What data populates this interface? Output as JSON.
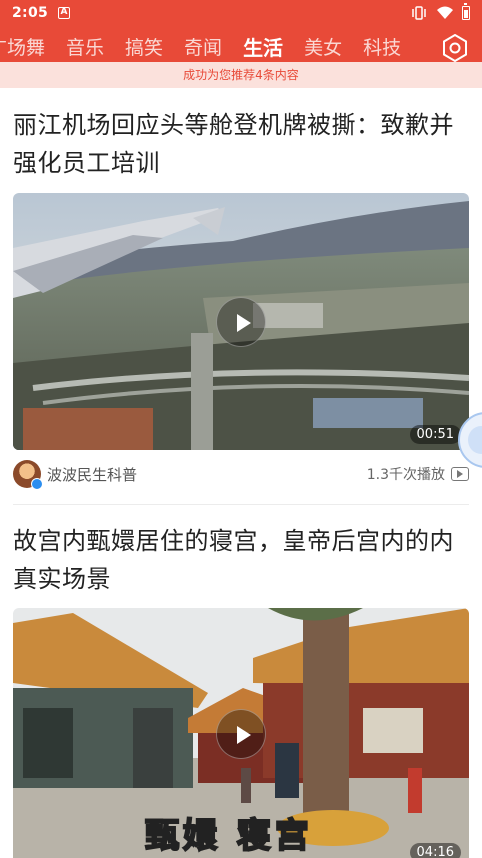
{
  "status_bar": {
    "time": "2:05",
    "notification_badge": "A",
    "icons": [
      "vibrate-icon",
      "wifi-icon",
      "battery-icon"
    ]
  },
  "tabs": [
    {
      "label": "广场舞",
      "active": false
    },
    {
      "label": "音乐",
      "active": false
    },
    {
      "label": "搞笑",
      "active": false
    },
    {
      "label": "奇闻",
      "active": false
    },
    {
      "label": "生活",
      "active": true
    },
    {
      "label": "美女",
      "active": false
    },
    {
      "label": "科技",
      "active": false
    }
  ],
  "toast": "成功为您推荐4条内容",
  "articles": [
    {
      "title": "丽江机场回应头等舱登机牌被撕：致歉并强化员工培训",
      "duration": "00:51",
      "source": "波波民生科普",
      "plays": "1.3千次播放"
    },
    {
      "title": "故宫内甄嬛居住的寝宫，皇帝后宫内的内真实场景",
      "duration": "04:16",
      "caption": "甄嬛 寝宫"
    }
  ],
  "colors": {
    "brand": "#e84a38",
    "toast_bg": "#fbe1dc"
  }
}
